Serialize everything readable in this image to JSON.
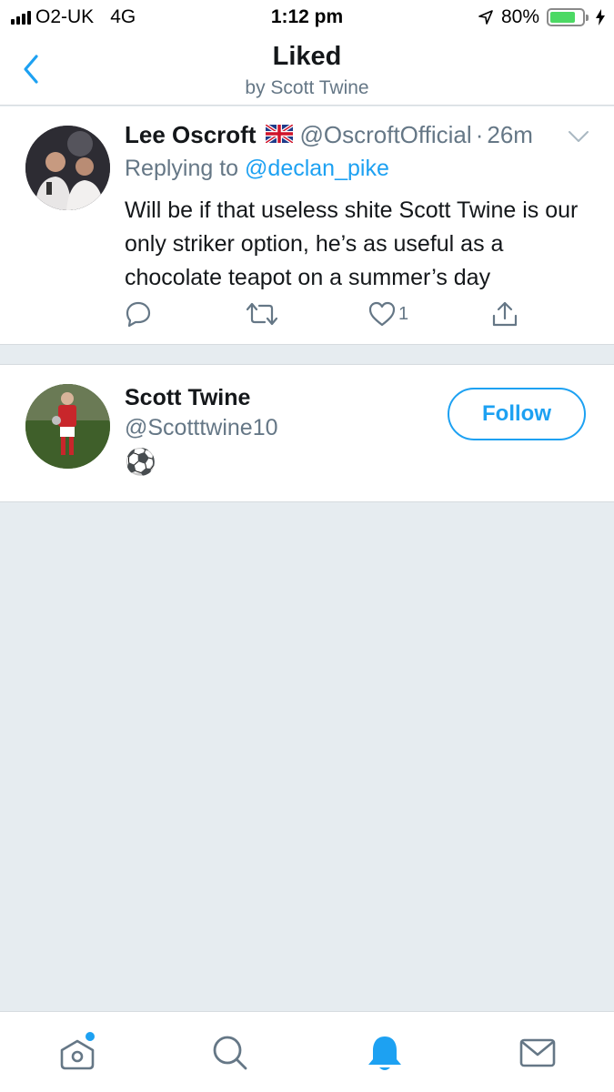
{
  "status_bar": {
    "carrier": "O2-UK",
    "network": "4G",
    "time": "1:12 pm",
    "battery": "80%",
    "battery_level": 0.8,
    "battery_color": "#4cd964"
  },
  "header": {
    "back_icon": "chevron-left-icon",
    "title": "Liked",
    "subtitle": "by Scott Twine"
  },
  "tweet": {
    "name": "Lee Oscroft",
    "flag": "🇬🇧",
    "handle": "@OscroftOfficial",
    "dot": "·",
    "time": "26m",
    "replying_prefix": "Replying to",
    "replying_to": "@declan_pike",
    "text": "Will be if that useless shite Scott Twine is our only striker option, he’s as useful as a chocolate teapot on a summer’s day",
    "actions": {
      "reply_icon": "reply-icon",
      "retweet_icon": "retweet-icon",
      "like_icon": "heart-icon",
      "like_count": "1",
      "share_icon": "share-icon"
    }
  },
  "user": {
    "name": "Scott Twine",
    "handle": "@Scotttwine10",
    "bio": "⚽",
    "follow_label": "Follow"
  },
  "tab_bar": {
    "items": [
      "home-icon",
      "search-icon",
      "notifications-icon",
      "messages-icon"
    ],
    "active": "notifications-icon"
  },
  "colors": {
    "accent": "#1da1f2",
    "muted": "#657786",
    "background": "#e6ecf0"
  }
}
